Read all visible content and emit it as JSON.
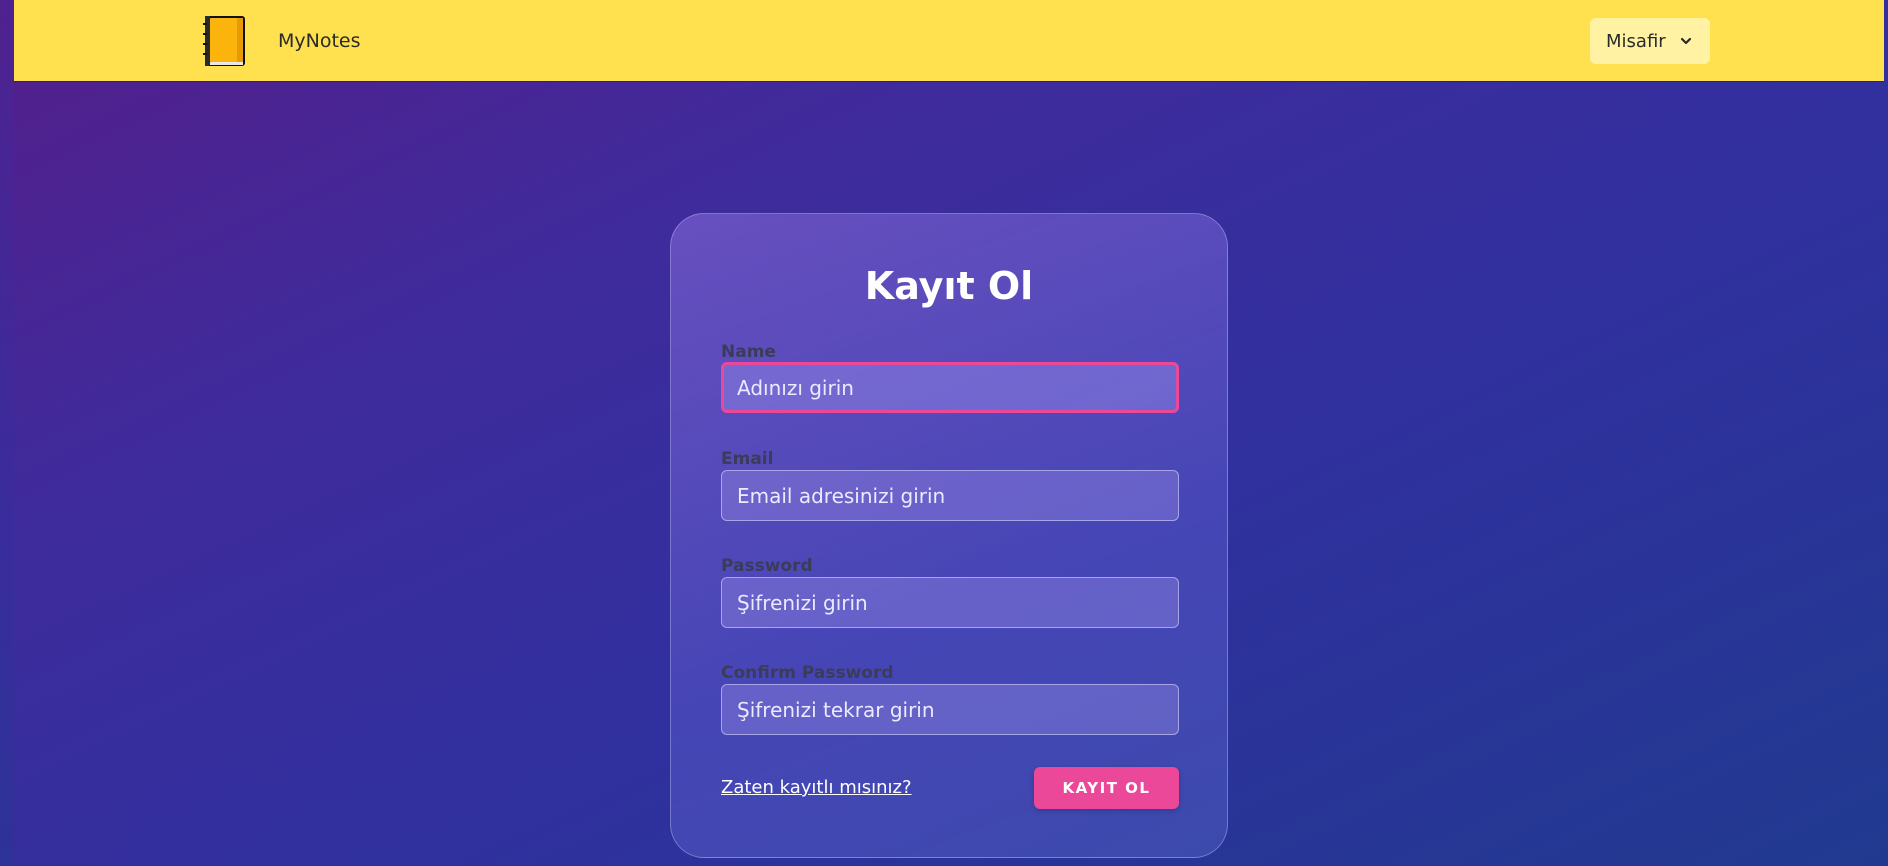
{
  "navbar": {
    "brand_name": "MyNotes",
    "logo_icon": "notebook-icon",
    "user_menu_label": "Misafir",
    "user_menu_icon": "chevron-down-icon",
    "background_color": "#ffe04e"
  },
  "form": {
    "title": "Kayıt Ol",
    "fields": [
      {
        "label": "Name",
        "placeholder": "Adınızı girin",
        "value": ""
      },
      {
        "label": "Email",
        "placeholder": "Email adresinizi girin",
        "value": ""
      },
      {
        "label": "Password",
        "placeholder": "Şifrenizi girin",
        "value": ""
      },
      {
        "label": "Confirm Password",
        "placeholder": "Şifrenizi tekrar girin",
        "value": ""
      }
    ],
    "login_link": "Zaten kayıtlı mısınız?",
    "submit_label": "KAYIT OL",
    "accent_color": "#ec4899"
  }
}
